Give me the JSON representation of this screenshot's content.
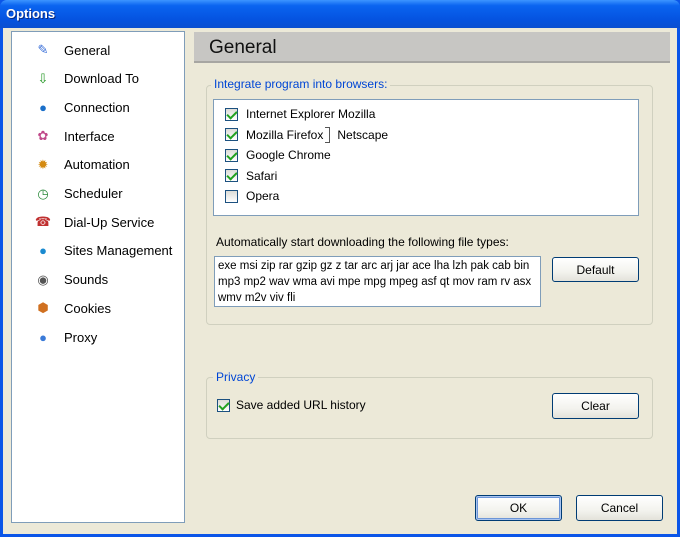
{
  "window": {
    "title": "Options"
  },
  "sidebar": {
    "items": [
      {
        "label": "General",
        "icon": "general-icon",
        "glyph": "✎",
        "color": "#3a6fd8"
      },
      {
        "label": "Download To",
        "icon": "download-to-icon",
        "glyph": "⇩",
        "color": "#2a9a2a"
      },
      {
        "label": "Connection",
        "icon": "connection-icon",
        "glyph": "●",
        "color": "#1a6fc9"
      },
      {
        "label": "Interface",
        "icon": "interface-icon",
        "glyph": "✿",
        "color": "#c04a8a"
      },
      {
        "label": "Automation",
        "icon": "automation-icon",
        "glyph": "✹",
        "color": "#d48a10"
      },
      {
        "label": "Scheduler",
        "icon": "scheduler-icon",
        "glyph": "◷",
        "color": "#2a8a3a"
      },
      {
        "label": "Dial-Up Service",
        "icon": "telephone-icon",
        "glyph": "☎",
        "color": "#c03030"
      },
      {
        "label": "Sites Management",
        "icon": "sites-icon",
        "glyph": "●",
        "color": "#1a8ad0"
      },
      {
        "label": "Sounds",
        "icon": "speaker-icon",
        "glyph": "◉",
        "color": "#555555"
      },
      {
        "label": "Cookies",
        "icon": "cookies-icon",
        "glyph": "⬢",
        "color": "#d07020"
      },
      {
        "label": "Proxy",
        "icon": "proxy-icon",
        "glyph": "●",
        "color": "#3a7ad8"
      }
    ]
  },
  "main": {
    "title": "General",
    "browsers": {
      "group_label": "Integrate program into browsers:",
      "items": [
        {
          "label": "Internet Explorer Mozilla",
          "checked": true
        },
        {
          "label": "Mozilla Firefox",
          "suffix": "Netscape",
          "checked": true
        },
        {
          "label": "Google Chrome",
          "checked": true
        },
        {
          "label": "Safari",
          "checked": true
        },
        {
          "label": "Opera",
          "checked": false
        }
      ]
    },
    "filetypes": {
      "label": "Automatically start  downloading the following file types:",
      "value": "exe msi zip rar gzip gz z tar arc arj jar ace lha lzh pak cab bin mp3 mp2 wav wma avi mpe mpg mpeg asf qt mov ram rv asx wmv m2v viv fli",
      "default_button": "Default"
    },
    "privacy": {
      "group_label": "Privacy",
      "save_history_label": "Save added URL history",
      "save_history_checked": true,
      "clear_button": "Clear"
    }
  },
  "footer": {
    "ok_label": "OK",
    "cancel_label": "Cancel"
  }
}
